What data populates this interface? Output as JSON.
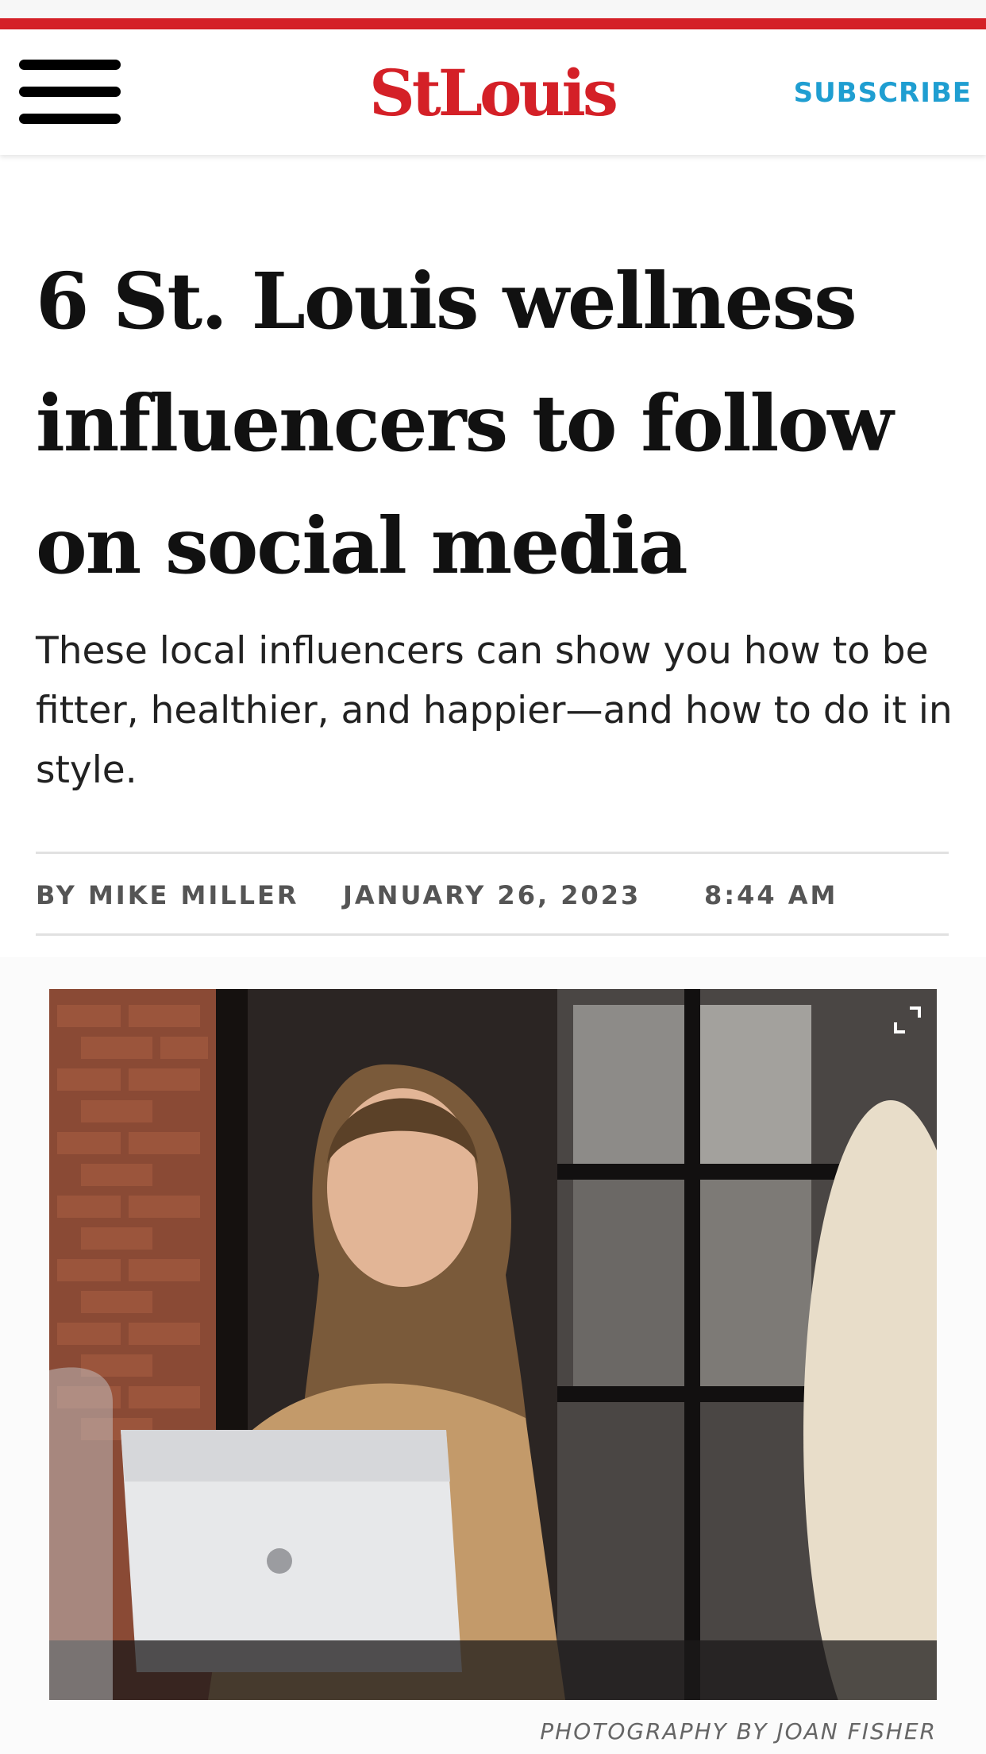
{
  "header": {
    "logo_text": "StLouis",
    "subscribe_label": "SUBSCRIBE",
    "menu_icon": "hamburger-menu-icon"
  },
  "article": {
    "headline": "6 St. Louis wellness influencers to follow on social media",
    "dek": "These local influencers can show you how to be fitter, healthier, and happier—and how to do it in style.",
    "byline": {
      "author": "BY MIKE MILLER",
      "date": "JANUARY 26, 2023",
      "time": "8:44 AM"
    },
    "photo": {
      "expand_icon": "expand-icon",
      "credit": "PHOTOGRAPHY BY JOAN FISHER"
    }
  },
  "colors": {
    "brand_red": "#d42027",
    "subscribe_blue": "#1f9ed1",
    "text_dark": "#111111"
  }
}
